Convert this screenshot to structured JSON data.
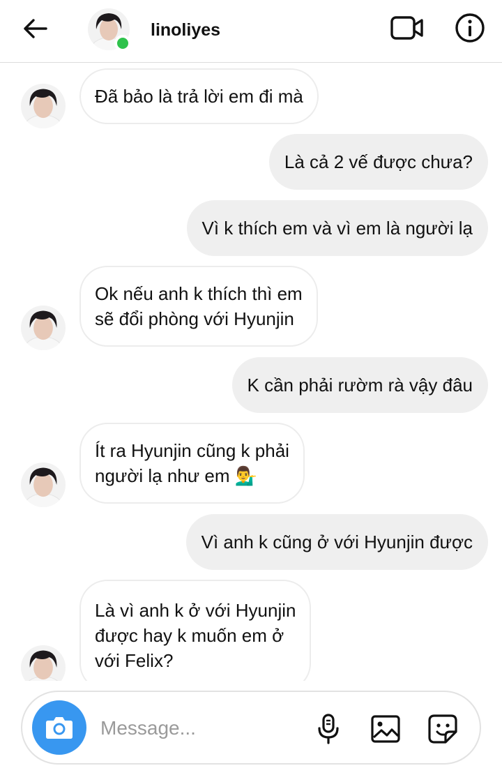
{
  "header": {
    "back_icon": "arrow-left-icon",
    "username": "linoliyes",
    "status_color": "#2ec24b",
    "video_icon": "video-camera-icon",
    "info_icon": "info-icon"
  },
  "messages": [
    {
      "from": "them",
      "lines": [
        "Đã bảo là trả lời em đi mà"
      ]
    },
    {
      "from": "me",
      "lines": [
        "Là cả 2 vế được chưa?"
      ]
    },
    {
      "from": "me",
      "lines": [
        "Vì k thích em và vì em là người lạ"
      ]
    },
    {
      "from": "them",
      "lines": [
        "Ok nếu anh k thích thì em",
        "sẽ đổi phòng với Hyunjin"
      ]
    },
    {
      "from": "me",
      "lines": [
        "K cần phải rườm rà vậy đâu"
      ]
    },
    {
      "from": "them",
      "lines": [
        "Ít ra Hyunjin cũng k phải",
        "người lạ như em 💁‍♂️"
      ]
    },
    {
      "from": "me",
      "lines": [
        "Vì anh k cũng ở với Hyunjin được"
      ]
    },
    {
      "from": "them",
      "lines": [
        "Là vì anh k ở với Hyunjin",
        "được hay k muốn em ở",
        "với Felix?"
      ]
    }
  ],
  "composer": {
    "placeholder": "Message...",
    "value": "",
    "camera_icon": "camera-icon",
    "mic_icon": "microphone-icon",
    "gallery_icon": "image-icon",
    "sticker_icon": "sticker-icon",
    "accent_color": "#3897f0"
  }
}
